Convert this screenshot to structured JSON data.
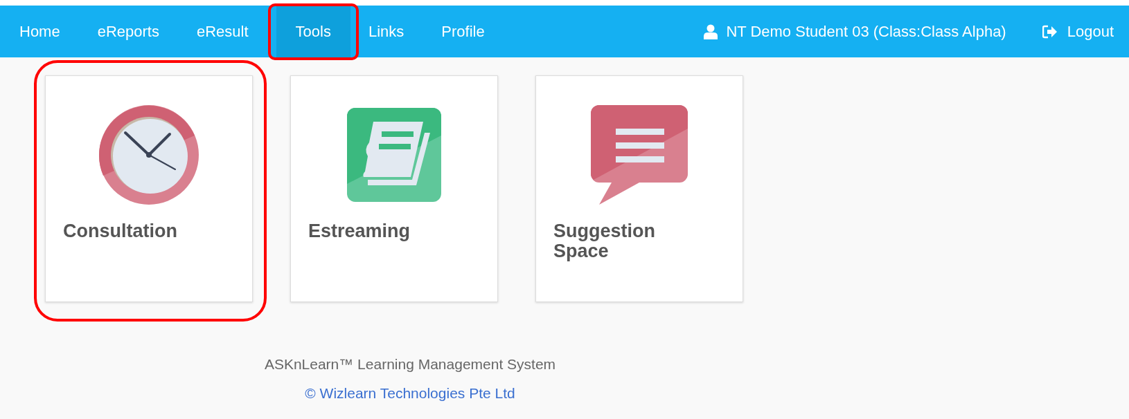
{
  "nav": {
    "items": [
      {
        "label": "Home",
        "selected": false,
        "highlighted": false
      },
      {
        "label": "eReports",
        "selected": false,
        "highlighted": false
      },
      {
        "label": "eResult",
        "selected": false,
        "highlighted": false
      },
      {
        "label": "Tools",
        "selected": true,
        "highlighted": true
      },
      {
        "label": "Links",
        "selected": false,
        "highlighted": false
      },
      {
        "label": "Profile",
        "selected": false,
        "highlighted": false
      }
    ],
    "user": "NT Demo Student 03 (Class:Class Alpha)",
    "logout": "Logout"
  },
  "tiles": [
    {
      "kind": "clock",
      "label": "Consultation",
      "highlighted": true
    },
    {
      "kind": "book",
      "label": "Estreaming",
      "highlighted": false
    },
    {
      "kind": "chat",
      "label": "Suggestion Space",
      "highlighted": false
    }
  ],
  "footer": {
    "system": "ASKnLearn™ Learning Management System",
    "copyright": "© Wizlearn Technologies Pte Ltd"
  }
}
